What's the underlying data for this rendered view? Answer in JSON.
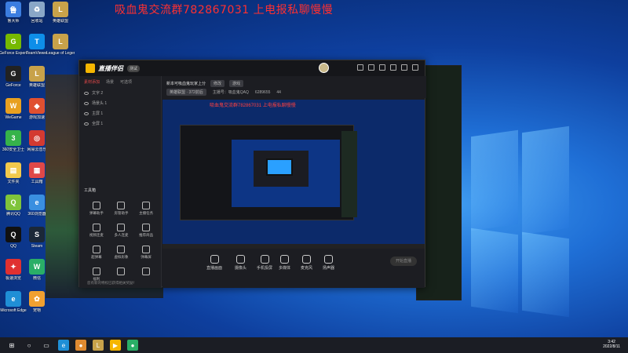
{
  "banner": "吸血鬼交流群782867031 上电报私聊慢慢",
  "desktop_icons": [
    {
      "label": "鲁大师",
      "color": "#3b7de0",
      "glyph": "鲁"
    },
    {
      "label": "回收站",
      "color": "#8aa7c7",
      "glyph": "♻"
    },
    {
      "label": "英雄联盟",
      "color": "#c8a24a",
      "glyph": "L"
    },
    {
      "label": "GeForce Experience",
      "color": "#76b900",
      "glyph": "G"
    },
    {
      "label": "TeamViewer",
      "color": "#0e8ee9",
      "glyph": "T"
    },
    {
      "label": "League of Legends",
      "color": "#c8a24a",
      "glyph": "L"
    },
    {
      "label": "GeForce",
      "color": "#222",
      "glyph": "G"
    },
    {
      "label": "英雄联盟",
      "color": "#c8a24a",
      "glyph": "L"
    },
    {
      "label": "WeGame",
      "color": "#e8a020",
      "glyph": "W"
    },
    {
      "label": "游戏加速",
      "color": "#e05030",
      "glyph": "◆"
    },
    {
      "label": "360安全卫士",
      "color": "#36b34a",
      "glyph": "3"
    },
    {
      "label": "网易云音乐",
      "color": "#d33a31",
      "glyph": "◎"
    },
    {
      "label": "文件夹",
      "color": "#f2c94c",
      "glyph": "▤"
    },
    {
      "label": "工具箱",
      "color": "#e04848",
      "glyph": "▦"
    },
    {
      "label": "腾讯QQ",
      "color": "#7fc43b",
      "glyph": "Q"
    },
    {
      "label": "360浏览器",
      "color": "#3a8fe0",
      "glyph": "e"
    },
    {
      "label": "QQ",
      "color": "#111",
      "glyph": "Q"
    },
    {
      "label": "Steam",
      "color": "#1b2838",
      "glyph": "S"
    },
    {
      "label": "极速浏览",
      "color": "#e03030",
      "glyph": "✦"
    },
    {
      "label": "微信",
      "color": "#2aae67",
      "glyph": "W"
    },
    {
      "label": "Microsoft Edge",
      "color": "#1f8fd6",
      "glyph": "e"
    },
    {
      "label": "宠物",
      "color": "#f0a030",
      "glyph": "✿"
    }
  ],
  "app": {
    "name": "直播伴侣",
    "badge": "测试",
    "tabs": [
      "素材添加",
      "场景",
      "可选项"
    ],
    "scenes": [
      "文字 2",
      "场景头 1",
      "主屏 1",
      "全屏 1"
    ],
    "tools_title": "工具箱",
    "tools": [
      "弹幕助手",
      "房管助手",
      "主播任务",
      "视频连麦",
      "多人连麦",
      "推荐商品",
      "超弹幕",
      "虚拟形象",
      "弹幕屏",
      "福利",
      "",
      ""
    ],
    "stream_title": "新本可吸血鬼玩家上分",
    "edit_label": "修改",
    "category": "游戏",
    "sub_left": "英雄联盟 · 372前后",
    "sub_mid": "主播号：吸血鬼QAQ",
    "sub_num": "6289655",
    "sub_hot": "44",
    "preview_banner": "吸血鬼交流群782867031 上电报私聊慢慢",
    "bottom_items": [
      "直播画面",
      "摄像头",
      "手机投屏",
      "多媒体",
      "麦克风",
      "扬声器"
    ],
    "start_live": "开始直播",
    "status": "您有新的特权已获得相关奖励！"
  },
  "clock": {
    "time": "3:42",
    "date": "2022/8/11"
  }
}
